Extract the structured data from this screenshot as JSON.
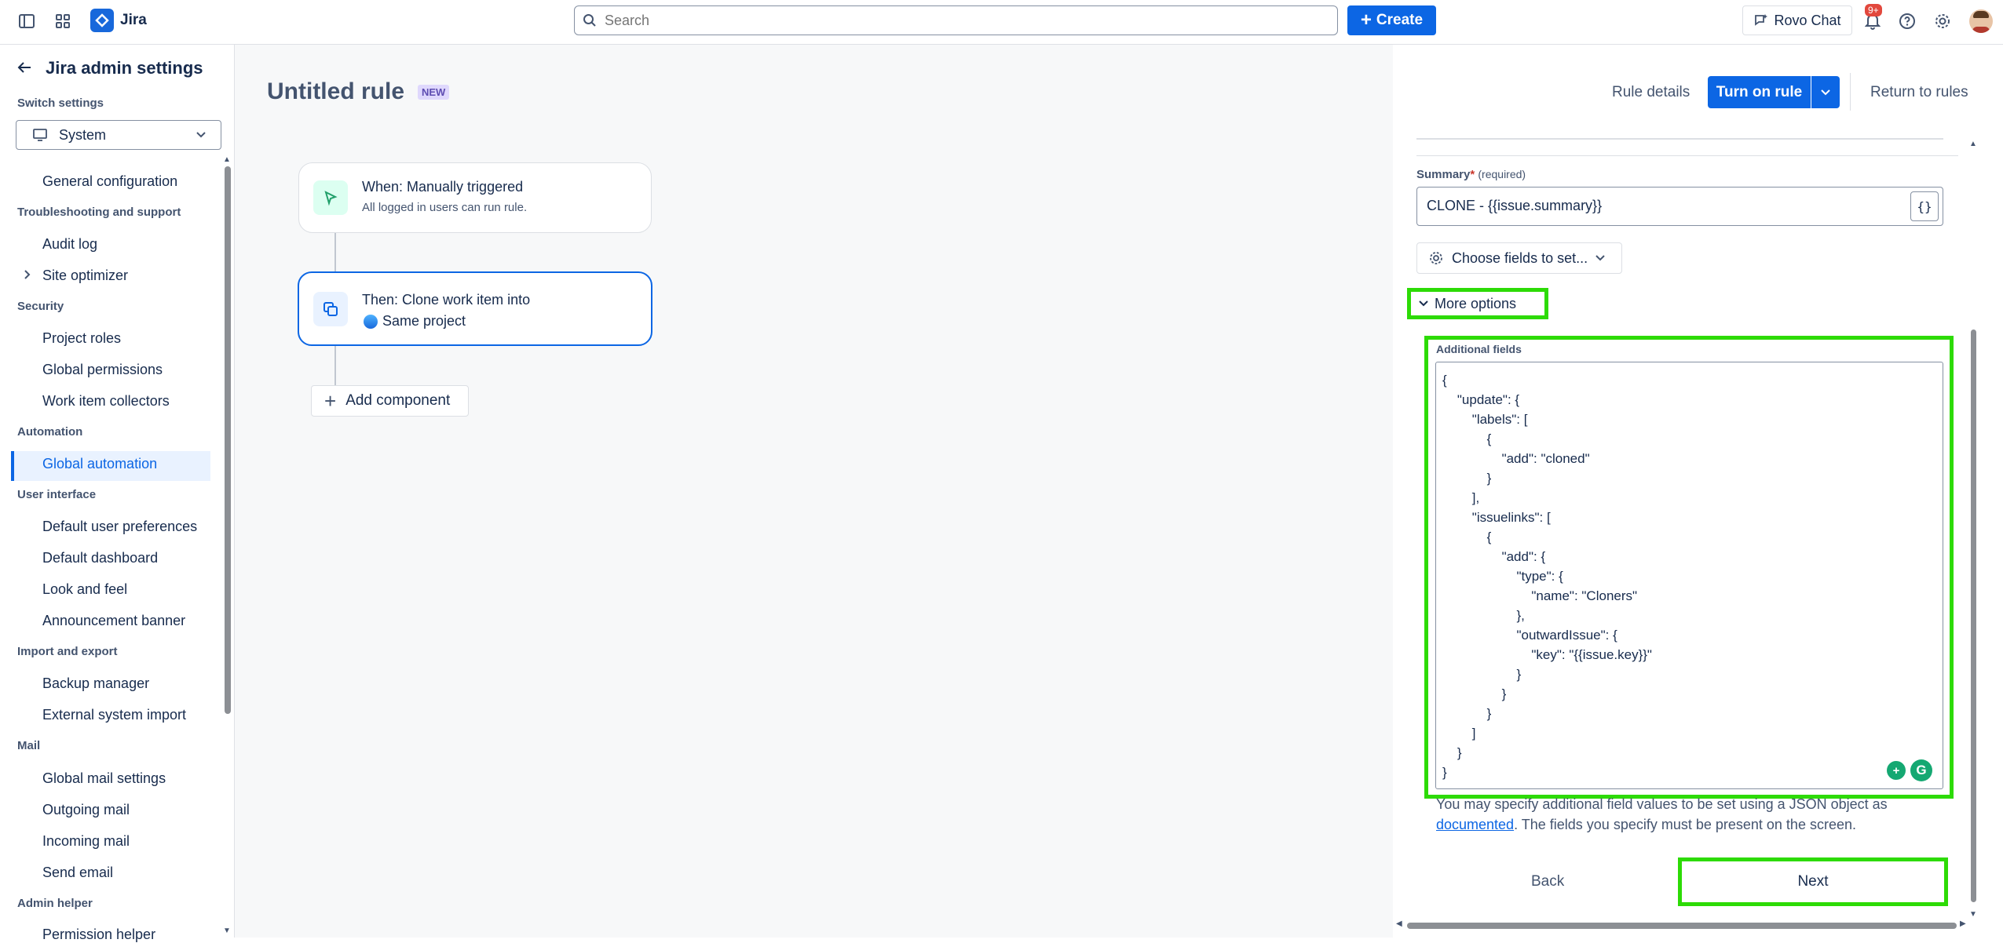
{
  "topbar": {
    "app_name": "Jira",
    "search_placeholder": "Search",
    "create_label": "Create",
    "rovo_label": "Rovo Chat",
    "notif_badge": "9+"
  },
  "sidebar": {
    "title": "Jira admin settings",
    "switch_label": "Switch settings",
    "switch_value": "System",
    "items": [
      {
        "type": "item",
        "label": "General configuration"
      },
      {
        "type": "section",
        "label": "Troubleshooting and support"
      },
      {
        "type": "item",
        "label": "Audit log"
      },
      {
        "type": "item",
        "label": "Site optimizer"
      },
      {
        "type": "section",
        "label": "Security"
      },
      {
        "type": "item",
        "label": "Project roles"
      },
      {
        "type": "item",
        "label": "Global permissions"
      },
      {
        "type": "item",
        "label": "Work item collectors"
      },
      {
        "type": "section",
        "label": "Automation"
      },
      {
        "type": "item",
        "label": "Global automation"
      },
      {
        "type": "section",
        "label": "User interface"
      },
      {
        "type": "item",
        "label": "Default user preferences"
      },
      {
        "type": "item",
        "label": "Default dashboard"
      },
      {
        "type": "item",
        "label": "Look and feel"
      },
      {
        "type": "item",
        "label": "Announcement banner"
      },
      {
        "type": "section",
        "label": "Import and export"
      },
      {
        "type": "item",
        "label": "Backup manager"
      },
      {
        "type": "item",
        "label": "External system import"
      },
      {
        "type": "section",
        "label": "Mail"
      },
      {
        "type": "item",
        "label": "Global mail settings"
      },
      {
        "type": "item",
        "label": "Outgoing mail"
      },
      {
        "type": "item",
        "label": "Incoming mail"
      },
      {
        "type": "item",
        "label": "Send email"
      },
      {
        "type": "section",
        "label": "Admin helper"
      },
      {
        "type": "item",
        "label": "Permission helper"
      }
    ]
  },
  "rule": {
    "title": "Untitled rule",
    "new_lozenge": "NEW",
    "trigger_title": "When: Manually triggered",
    "trigger_sub": "All logged in users can run rule.",
    "action_title": "Then: Clone work item into",
    "action_sub": "Same project",
    "add_component": "Add component"
  },
  "header": {
    "rule_details": "Rule details",
    "turn_on": "Turn on rule",
    "return": "Return to rules"
  },
  "form": {
    "summary_label": "Summary",
    "required_star": "*",
    "required_text": "(required)",
    "summary_value": "CLONE - {{issue.summary}}",
    "curly_label": "{}",
    "choose_fields": "Choose fields to set...",
    "more_options": "More options",
    "additional_label": "Additional fields",
    "json_value": "{\n    \"update\": {\n        \"labels\": [\n            {\n                \"add\": \"cloned\"\n            }\n        ],\n        \"issuelinks\": [\n            {\n                \"add\": {\n                    \"type\": {\n                        \"name\": \"Cloners\"\n                    },\n                    \"outwardIssue\": {\n                        \"key\": \"{{issue.key}}\"\n                    }\n                }\n            }\n        ]\n    }\n}",
    "help_pre": "You may specify additional field values to be set using a JSON object as ",
    "help_link": "documented",
    "help_post": ". The fields you specify must be present on the screen.",
    "back": "Back",
    "next": "Next"
  },
  "colors": {
    "accent": "#0c66e4",
    "highlight": "#2ddb06",
    "active_bg": "#e9f2ff"
  }
}
